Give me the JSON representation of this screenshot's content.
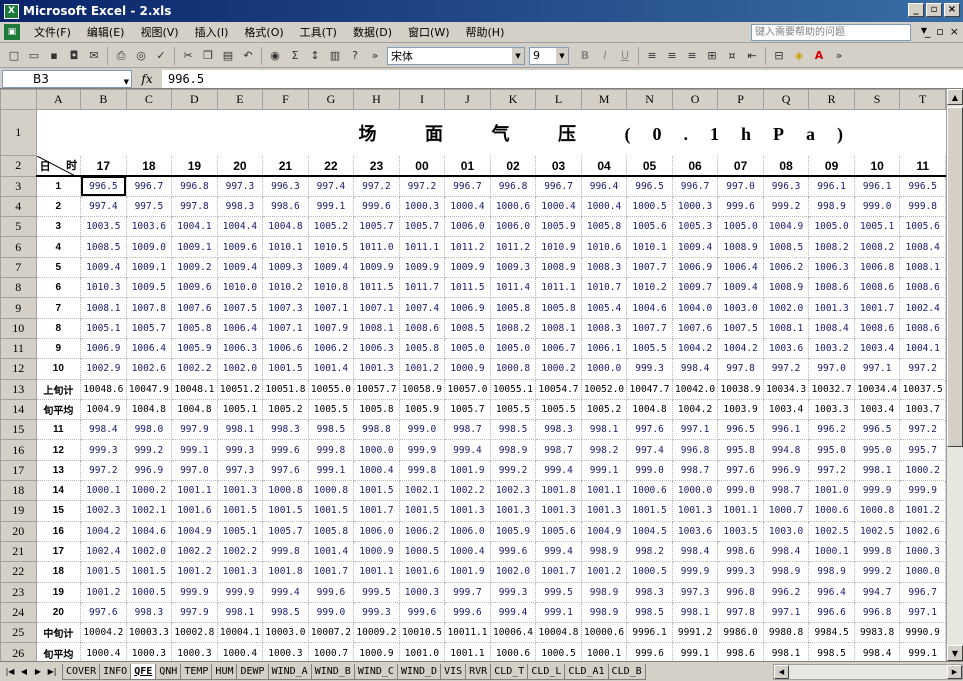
{
  "window": {
    "title": "Microsoft Excel - 2.xls",
    "app_icon": "X",
    "min": "_",
    "max": "▫",
    "close": "×"
  },
  "menu": {
    "items": [
      "文件(F)",
      "编辑(E)",
      "视图(V)",
      "插入(I)",
      "格式(O)",
      "工具(T)",
      "数据(D)",
      "窗口(W)",
      "帮助(H)"
    ],
    "help_placeholder": "键入需要帮助的问题"
  },
  "toolbar": {
    "font_name": "宋体",
    "font_size": "9"
  },
  "formula_bar": {
    "cell_ref": "B3",
    "fx": "fx",
    "value": "996.5"
  },
  "sheet": {
    "columns": [
      "A",
      "B",
      "C",
      "D",
      "E",
      "F",
      "G",
      "H",
      "I",
      "J",
      "K",
      "L",
      "M",
      "N",
      "O",
      "P",
      "Q",
      "R",
      "S",
      "T"
    ],
    "row_numbers": [
      "1",
      "2",
      "3",
      "4",
      "5",
      "6",
      "7",
      "8",
      "9",
      "10",
      "11",
      "12",
      "13",
      "14",
      "15",
      "16",
      "17",
      "18",
      "19",
      "20",
      "21",
      "22",
      "23",
      "24",
      "25",
      "26"
    ],
    "title": "场 面 气 压",
    "title_unit": "(0.1hPa)",
    "corner_hour": "时",
    "corner_day": "日",
    "hours": [
      "17",
      "18",
      "19",
      "20",
      "21",
      "22",
      "23",
      "00",
      "01",
      "02",
      "03",
      "04",
      "05",
      "06",
      "07",
      "08",
      "09",
      "10",
      "11"
    ],
    "rows": [
      {
        "label": "1",
        "values": [
          "996.5",
          "996.7",
          "996.8",
          "997.3",
          "996.3",
          "997.4",
          "997.2",
          "997.2",
          "996.7",
          "996.8",
          "996.7",
          "996.4",
          "996.5",
          "996.7",
          "997.0",
          "996.3",
          "996.1",
          "996.1",
          "996.5"
        ]
      },
      {
        "label": "2",
        "values": [
          "997.4",
          "997.5",
          "997.8",
          "998.3",
          "998.6",
          "999.1",
          "999.6",
          "1000.3",
          "1000.4",
          "1000.6",
          "1000.4",
          "1000.4",
          "1000.5",
          "1000.3",
          "999.6",
          "999.2",
          "998.9",
          "999.0",
          "999.8"
        ]
      },
      {
        "label": "3",
        "values": [
          "1003.5",
          "1003.6",
          "1004.1",
          "1004.4",
          "1004.8",
          "1005.2",
          "1005.7",
          "1005.7",
          "1006.0",
          "1006.0",
          "1005.9",
          "1005.8",
          "1005.6",
          "1005.3",
          "1005.0",
          "1004.9",
          "1005.0",
          "1005.1",
          "1005.6"
        ]
      },
      {
        "label": "4",
        "values": [
          "1008.5",
          "1009.0",
          "1009.1",
          "1009.6",
          "1010.1",
          "1010.5",
          "1011.0",
          "1011.1",
          "1011.2",
          "1011.2",
          "1010.9",
          "1010.6",
          "1010.1",
          "1009.4",
          "1008.9",
          "1008.5",
          "1008.2",
          "1008.2",
          "1008.4"
        ]
      },
      {
        "label": "5",
        "values": [
          "1009.4",
          "1009.1",
          "1009.2",
          "1009.4",
          "1009.3",
          "1009.4",
          "1009.9",
          "1009.9",
          "1009.9",
          "1009.3",
          "1008.9",
          "1008.3",
          "1007.7",
          "1006.9",
          "1006.4",
          "1006.2",
          "1006.3",
          "1006.8",
          "1008.1"
        ]
      },
      {
        "label": "6",
        "values": [
          "1010.3",
          "1009.5",
          "1009.6",
          "1010.0",
          "1010.2",
          "1010.8",
          "1011.5",
          "1011.7",
          "1011.5",
          "1011.4",
          "1011.1",
          "1010.7",
          "1010.2",
          "1009.7",
          "1009.4",
          "1008.9",
          "1008.6",
          "1008.6",
          "1008.6"
        ]
      },
      {
        "label": "7",
        "values": [
          "1008.1",
          "1007.8",
          "1007.6",
          "1007.5",
          "1007.3",
          "1007.1",
          "1007.1",
          "1007.4",
          "1006.9",
          "1005.8",
          "1005.8",
          "1005.4",
          "1004.6",
          "1004.0",
          "1003.0",
          "1002.0",
          "1001.3",
          "1001.7",
          "1002.4"
        ]
      },
      {
        "label": "8",
        "values": [
          "1005.1",
          "1005.7",
          "1005.8",
          "1006.4",
          "1007.1",
          "1007.9",
          "1008.1",
          "1008.6",
          "1008.5",
          "1008.2",
          "1008.1",
          "1008.3",
          "1007.7",
          "1007.6",
          "1007.5",
          "1008.1",
          "1008.4",
          "1008.6",
          "1008.6"
        ]
      },
      {
        "label": "9",
        "values": [
          "1006.9",
          "1006.4",
          "1005.9",
          "1006.3",
          "1006.6",
          "1006.2",
          "1006.3",
          "1005.8",
          "1005.0",
          "1005.0",
          "1006.7",
          "1006.1",
          "1005.5",
          "1004.2",
          "1004.2",
          "1003.6",
          "1003.2",
          "1003.4",
          "1004.1"
        ]
      },
      {
        "label": "10",
        "values": [
          "1002.9",
          "1002.6",
          "1002.2",
          "1002.0",
          "1001.5",
          "1001.4",
          "1001.3",
          "1001.2",
          "1000.9",
          "1000.8",
          "1000.2",
          "1000.0",
          "999.3",
          "998.4",
          "997.8",
          "997.2",
          "997.0",
          "997.1",
          "997.2"
        ]
      },
      {
        "label": "上旬计",
        "values": [
          "10048.6",
          "10047.9",
          "10048.1",
          "10051.2",
          "10051.8",
          "10055.0",
          "10057.7",
          "10058.9",
          "10057.0",
          "10055.1",
          "10054.7",
          "10052.0",
          "10047.7",
          "10042.0",
          "10038.9",
          "10034.3",
          "10032.7",
          "10034.4",
          "10037.5"
        ],
        "sum": true
      },
      {
        "label": "旬平均",
        "values": [
          "1004.9",
          "1004.8",
          "1004.8",
          "1005.1",
          "1005.2",
          "1005.5",
          "1005.8",
          "1005.9",
          "1005.7",
          "1005.5",
          "1005.5",
          "1005.2",
          "1004.8",
          "1004.2",
          "1003.9",
          "1003.4",
          "1003.3",
          "1003.4",
          "1003.7"
        ],
        "sum": true
      },
      {
        "label": "11",
        "values": [
          "998.4",
          "998.0",
          "997.9",
          "998.1",
          "998.3",
          "998.5",
          "998.8",
          "999.0",
          "998.7",
          "998.5",
          "998.3",
          "998.1",
          "997.6",
          "997.1",
          "996.5",
          "996.1",
          "996.2",
          "996.5",
          "997.2"
        ]
      },
      {
        "label": "12",
        "values": [
          "999.3",
          "999.2",
          "999.1",
          "999.3",
          "999.6",
          "999.8",
          "1000.0",
          "999.9",
          "999.4",
          "998.9",
          "998.7",
          "998.2",
          "997.4",
          "996.8",
          "995.8",
          "994.8",
          "995.0",
          "995.0",
          "995.7"
        ]
      },
      {
        "label": "13",
        "values": [
          "997.2",
          "996.9",
          "997.0",
          "997.3",
          "997.6",
          "999.1",
          "1000.4",
          "999.8",
          "1001.9",
          "999.2",
          "999.4",
          "999.1",
          "999.0",
          "998.7",
          "997.6",
          "996.9",
          "997.2",
          "998.1",
          "1000.2"
        ]
      },
      {
        "label": "14",
        "values": [
          "1000.1",
          "1000.2",
          "1001.1",
          "1001.3",
          "1000.8",
          "1000.8",
          "1001.5",
          "1002.1",
          "1002.2",
          "1002.3",
          "1001.8",
          "1001.1",
          "1000.6",
          "1000.0",
          "999.0",
          "998.7",
          "1001.0",
          "999.9",
          "999.9"
        ]
      },
      {
        "label": "15",
        "values": [
          "1002.3",
          "1002.1",
          "1001.6",
          "1001.5",
          "1001.5",
          "1001.5",
          "1001.7",
          "1001.5",
          "1001.3",
          "1001.3",
          "1001.3",
          "1001.3",
          "1001.5",
          "1001.3",
          "1001.1",
          "1000.7",
          "1000.6",
          "1000.8",
          "1001.2"
        ]
      },
      {
        "label": "16",
        "values": [
          "1004.2",
          "1004.6",
          "1004.9",
          "1005.1",
          "1005.7",
          "1005.8",
          "1006.0",
          "1006.2",
          "1006.0",
          "1005.9",
          "1005.6",
          "1004.9",
          "1004.5",
          "1003.6",
          "1003.5",
          "1003.0",
          "1002.5",
          "1002.5",
          "1002.6"
        ]
      },
      {
        "label": "17",
        "values": [
          "1002.4",
          "1002.0",
          "1002.2",
          "1002.2",
          "999.8",
          "1001.4",
          "1000.9",
          "1000.5",
          "1000.4",
          "999.6",
          "999.4",
          "998.9",
          "998.2",
          "998.4",
          "998.6",
          "998.4",
          "1000.1",
          "999.8",
          "1000.3"
        ]
      },
      {
        "label": "18",
        "values": [
          "1001.5",
          "1001.5",
          "1001.2",
          "1001.3",
          "1001.8",
          "1001.7",
          "1001.1",
          "1001.6",
          "1001.9",
          "1002.0",
          "1001.7",
          "1001.2",
          "1000.5",
          "999.9",
          "999.3",
          "998.9",
          "998.9",
          "999.2",
          "1000.0"
        ]
      },
      {
        "label": "19",
        "values": [
          "1001.2",
          "1000.5",
          "999.9",
          "999.9",
          "999.4",
          "999.6",
          "999.5",
          "1000.3",
          "999.7",
          "999.3",
          "999.5",
          "998.9",
          "998.3",
          "997.3",
          "996.8",
          "996.2",
          "996.4",
          "994.7",
          "996.7"
        ]
      },
      {
        "label": "20",
        "values": [
          "997.6",
          "998.3",
          "997.9",
          "998.1",
          "998.5",
          "999.0",
          "999.3",
          "999.6",
          "999.6",
          "999.4",
          "999.1",
          "998.9",
          "998.5",
          "998.1",
          "997.8",
          "997.1",
          "996.6",
          "996.8",
          "997.1"
        ]
      },
      {
        "label": "中旬计",
        "values": [
          "10004.2",
          "10003.3",
          "10002.8",
          "10004.1",
          "10003.0",
          "10007.2",
          "10009.2",
          "10010.5",
          "10011.1",
          "10006.4",
          "10004.8",
          "10000.6",
          "9996.1",
          "9991.2",
          "9986.0",
          "9980.8",
          "9984.5",
          "9983.8",
          "9990.9"
        ],
        "sum": true
      },
      {
        "label": "旬平均",
        "values": [
          "1000.4",
          "1000.3",
          "1000.3",
          "1000.4",
          "1000.3",
          "1000.7",
          "1000.9",
          "1001.0",
          "1001.1",
          "1000.6",
          "1000.5",
          "1000.1",
          "999.6",
          "999.1",
          "998.6",
          "998.1",
          "998.5",
          "998.4",
          "999.1"
        ],
        "sum": true
      }
    ]
  },
  "tabs": {
    "nav": [
      "|◀",
      "◀",
      "▶",
      "▶|"
    ],
    "sheets": [
      "COVER",
      "INFO",
      "QFE",
      "QNH",
      "TEMP",
      "HUM",
      "DEWP",
      "WIND_A",
      "WIND_B",
      "WIND_C",
      "WIND_D",
      "VIS",
      "RVR",
      "CLD_T",
      "CLD_L",
      "CLD_A1",
      "CLD_B"
    ],
    "active": "QFE"
  }
}
